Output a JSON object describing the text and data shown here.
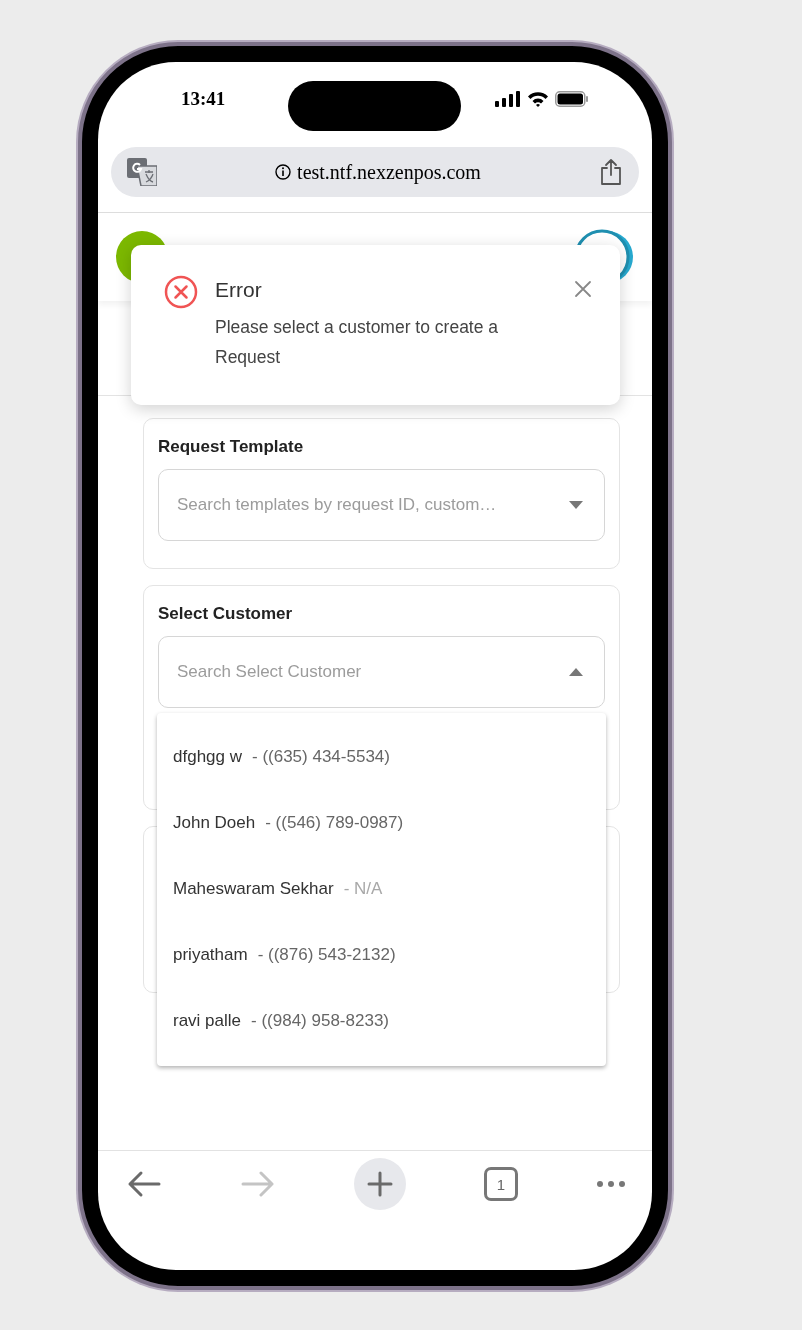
{
  "status_bar": {
    "time": "13:41"
  },
  "address_bar": {
    "url": "test.ntf.nexzenpos.com"
  },
  "toast": {
    "kind": "error",
    "title": "Error",
    "message": "Please select a customer to create a Request"
  },
  "form": {
    "sections": [
      {
        "label": "Request Template",
        "placeholder": "Search templates by request ID, custom…",
        "expanded": false
      },
      {
        "label": "Select Customer",
        "placeholder": "Search Select Customer",
        "expanded": true
      }
    ]
  },
  "customer_options": [
    {
      "name": "dfghgg w",
      "detail": "- ((635) 434-5534)",
      "kind": "phone"
    },
    {
      "name": "John Doeh",
      "detail": "- ((546) 789-0987)",
      "kind": "phone"
    },
    {
      "name": "Maheswaram Sekhar",
      "detail": "- N/A",
      "kind": "none"
    },
    {
      "name": "priyatham",
      "detail": "- ((876) 543-2132)",
      "kind": "phone"
    },
    {
      "name": "ravi palle",
      "detail": "- ((984) 958-8233)",
      "kind": "phone"
    }
  ],
  "nav_buttons": [
    {
      "kind": "back",
      "disabled": false
    },
    {
      "kind": "forward",
      "disabled": true
    },
    {
      "kind": "new_tab"
    },
    {
      "kind": "tabs",
      "count": "1"
    },
    {
      "kind": "more"
    }
  ]
}
